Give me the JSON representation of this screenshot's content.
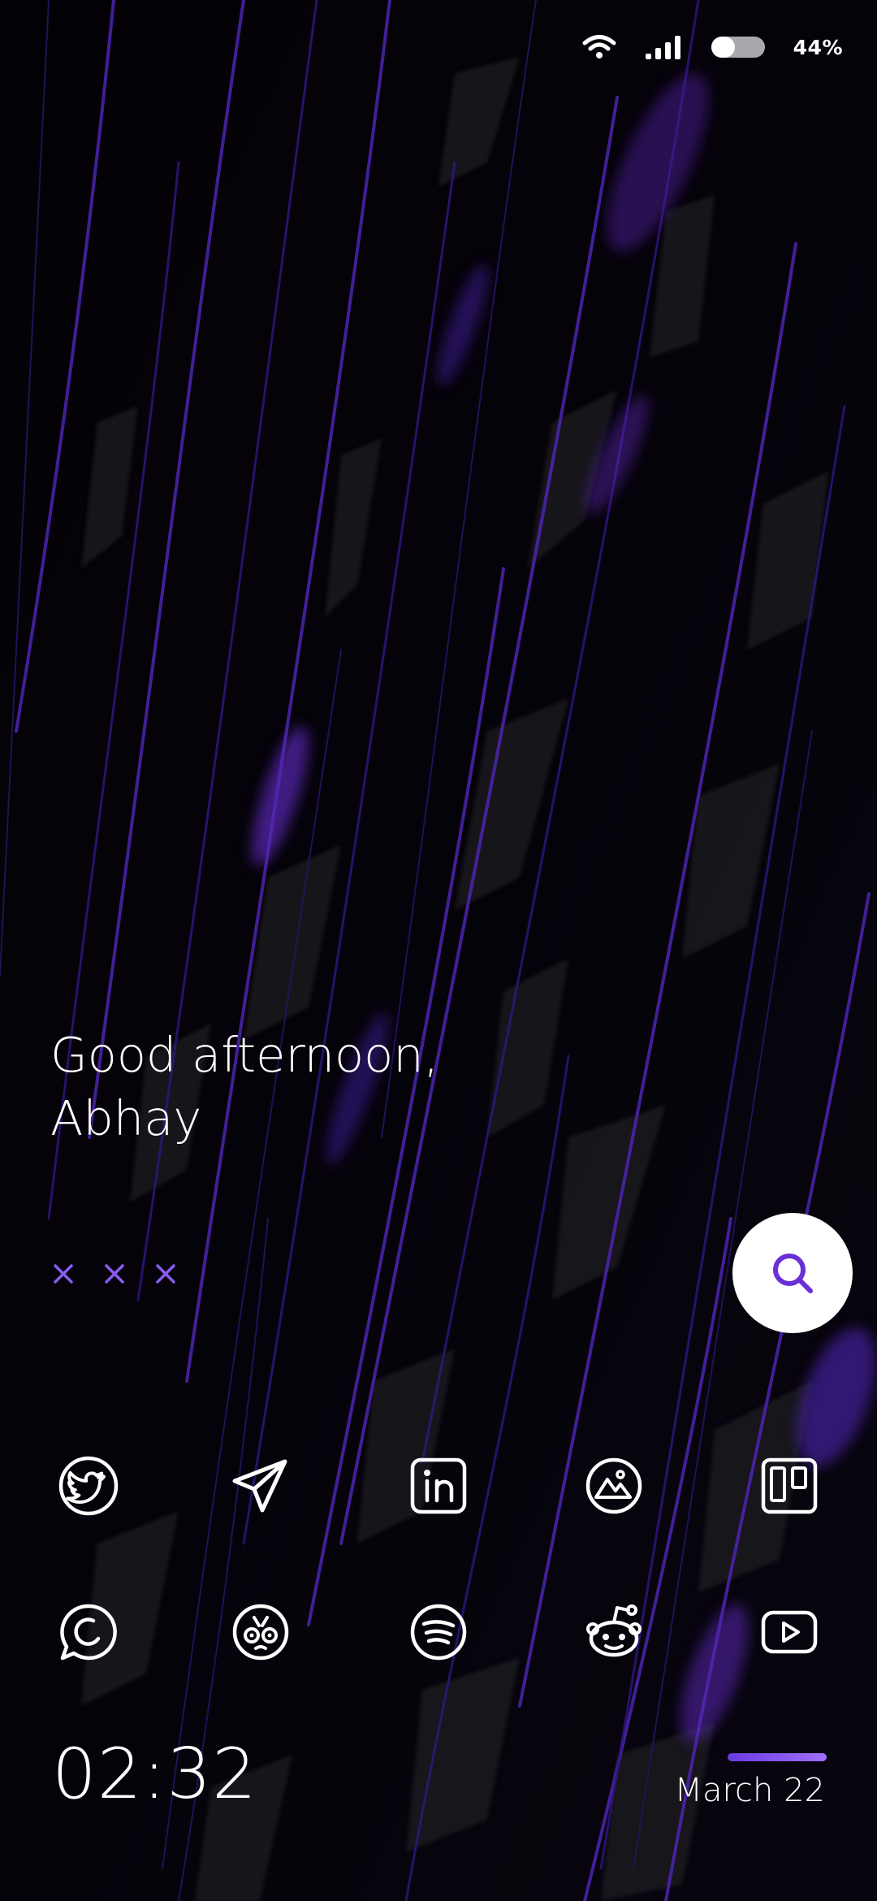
{
  "status_bar": {
    "battery_percent": "44%",
    "battery_level": 0.44,
    "icons": [
      "wifi-icon",
      "signal-icon",
      "battery-icon"
    ]
  },
  "greeting": {
    "line1": "Good afternoon,",
    "line2": "Abhay"
  },
  "marks": [
    "×",
    "×",
    "×"
  ],
  "accent_color": "#6a2fd6",
  "search": {
    "icon": "search-icon"
  },
  "apps": [
    [
      {
        "name": "Twitter",
        "icon": "twitter-icon"
      },
      {
        "name": "Telegram",
        "icon": "telegram-icon"
      },
      {
        "name": "LinkedIn",
        "icon": "linkedin-icon"
      },
      {
        "name": "Photos",
        "icon": "photos-icon"
      },
      {
        "name": "Trello",
        "icon": "trello-icon"
      }
    ],
    [
      {
        "name": "WhatsApp",
        "icon": "whatsapp-icon"
      },
      {
        "name": "Cartoon face app",
        "icon": "cartoon-face-icon"
      },
      {
        "name": "Spotify",
        "icon": "spotify-icon"
      },
      {
        "name": "Reddit",
        "icon": "reddit-icon"
      },
      {
        "name": "YouTube",
        "icon": "youtube-icon"
      }
    ]
  ],
  "clock": {
    "time": "02:32"
  },
  "date": {
    "text": "March 22"
  }
}
